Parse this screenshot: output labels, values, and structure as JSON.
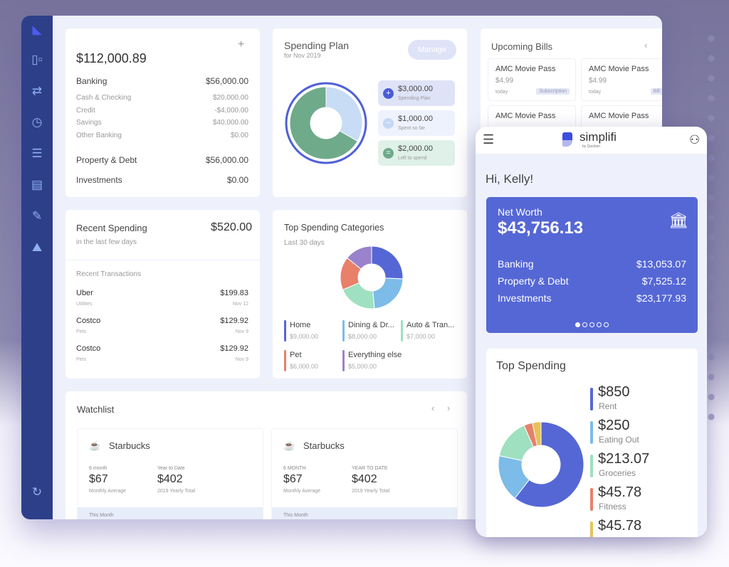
{
  "sidebar": {
    "icons": [
      "logo-icon",
      "dashboard-icon",
      "transfer-icon",
      "calendar-clock-icon",
      "list-icon",
      "report-icon",
      "edit-icon",
      "investment-icon",
      "refresh-icon"
    ]
  },
  "net_worth_card": {
    "add": "+",
    "total": "$112,000.89",
    "banking": {
      "label": "Banking",
      "value": "$56,000.00"
    },
    "sub": [
      {
        "label": "Cash & Checking",
        "value": "$20,000.00"
      },
      {
        "label": "Credit",
        "value": "-$4,000.00"
      },
      {
        "label": "Savings",
        "value": "$40,000.00"
      },
      {
        "label": "Other Banking",
        "value": "$0.00"
      }
    ],
    "property": {
      "label": "Property & Debt",
      "value": "$56,000.00"
    },
    "investments": {
      "label": "Investments",
      "value": "$0.00"
    }
  },
  "spending_plan": {
    "title": "Spending Plan",
    "subtitle": "for Nov 2019",
    "manage": "Manage",
    "items": [
      {
        "value": "$3,000.00",
        "label": "Spending Plan",
        "icon": "+"
      },
      {
        "value": "$1,000.00",
        "label": "Spent so far",
        "icon": "−"
      },
      {
        "value": "$2,000.00",
        "label": "Left to spend",
        "icon": "="
      }
    ],
    "colors": {
      "spent": "#c8dcf5",
      "left": "#6faa8a",
      "ring": "#5060d8"
    }
  },
  "bills": {
    "title": "Upcoming Bills",
    "items": [
      {
        "name": "AMC Movie Pass",
        "amount": "$4.99",
        "date": "today",
        "tag": "Subscription"
      },
      {
        "name": "AMC Movie Pass",
        "amount": "$4.99",
        "date": "today",
        "tag": "Bill"
      },
      {
        "name": "AMC Movie Pass"
      },
      {
        "name": "AMC Movie Pass"
      }
    ]
  },
  "recent": {
    "title": "Recent Spending",
    "subtitle": "in the last few days",
    "total": "$520.00",
    "section": "Recent Transactions",
    "rows": [
      {
        "name": "Uber",
        "cat": "Utilities",
        "amount": "$199.83",
        "date": "Nov 12"
      },
      {
        "name": "Costco",
        "cat": "Pets",
        "amount": "$129.92",
        "date": "Nov 9"
      },
      {
        "name": "Costco",
        "cat": "Pets",
        "amount": "$129.92",
        "date": "Nov 9"
      }
    ]
  },
  "top_categories": {
    "title": "Top Spending Categories",
    "subtitle": "Last 30 days"
  },
  "watchlist": {
    "title": "Watchlist",
    "cards": [
      {
        "name": "Starbucks",
        "l1": "6 month",
        "v1": "$67",
        "d1": "Monthly Average",
        "l2": "Year to Date",
        "v2": "$402",
        "d2": "2019 Yearly Total",
        "foot": "This Month"
      },
      {
        "name": "Starbucks",
        "l1": "6 MONTH",
        "v1": "$67",
        "d1": "Monthly Average",
        "l2": "YEAR TO DATE",
        "v2": "$402",
        "d2": "2019 Yearly Total",
        "foot": "This Month"
      }
    ]
  },
  "phone": {
    "brand": "simplifi",
    "brand_sub": "by Quicken",
    "greeting": "Hi, Kelly!",
    "nw_label": "Net Worth",
    "nw_value": "$43,756.13",
    "rows": [
      {
        "label": "Banking",
        "value": "$13,053.07"
      },
      {
        "label": "Property & Debt",
        "value": "$7,525.12"
      },
      {
        "label": "Investments",
        "value": "$23,177.93"
      }
    ],
    "carousel_page": 1,
    "carousel_pages": 5,
    "top_title": "Top Spending"
  },
  "chart_data": [
    {
      "type": "pie",
      "title": "Spending Plan",
      "categories": [
        "Spent so far",
        "Left to spend"
      ],
      "values": [
        1000,
        2000
      ]
    },
    {
      "type": "pie",
      "title": "Top Spending Categories",
      "categories": [
        "Home",
        "Dining & Dr...",
        "Auto & Tran...",
        "Pet",
        "Everything else"
      ],
      "labels": [
        "$9,000.00",
        "$8,000.00",
        "$7,000.00",
        "$6,000.00",
        "$5,000.00"
      ],
      "values": [
        9000,
        8000,
        7000,
        6000,
        5000
      ],
      "colors": [
        "#5567d5",
        "#7dbbe8",
        "#9ee0c0",
        "#e8806a",
        "#9a82cc"
      ]
    },
    {
      "type": "pie",
      "title": "Top Spending",
      "categories": [
        "Rent",
        "Eating Out",
        "Groceries",
        "Fitness",
        ""
      ],
      "labels": [
        "$850",
        "$250",
        "$213.07",
        "$45.78",
        "$45.78"
      ],
      "values": [
        850,
        250,
        213.07,
        45.78,
        45.78
      ],
      "colors": [
        "#5567d5",
        "#7dbbe8",
        "#9ee0c0",
        "#e8806a",
        "#e6c35a"
      ]
    }
  ]
}
